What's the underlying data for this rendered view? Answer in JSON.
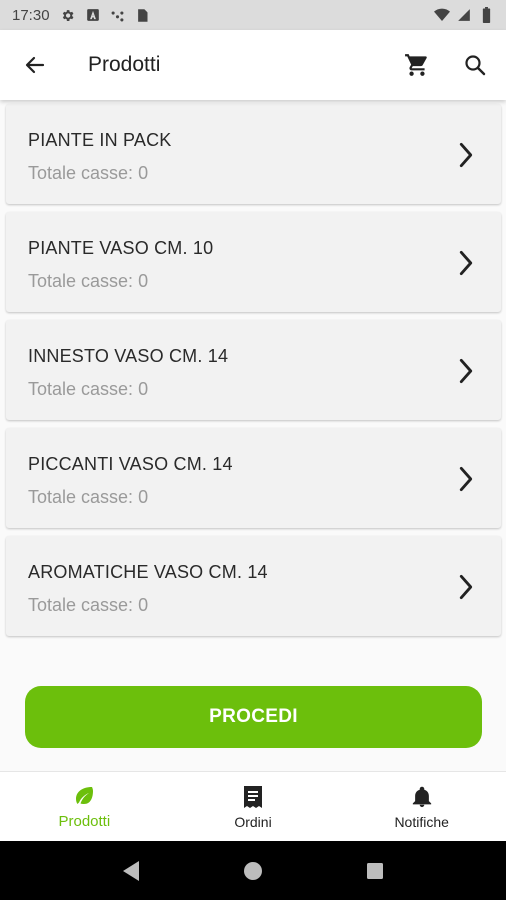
{
  "status_bar": {
    "time": "17:30",
    "icons_left": [
      "gear-icon",
      "a-icon",
      "wifi-dots-icon",
      "sim-icon"
    ],
    "icons_right": [
      "wifi-icon",
      "signal-icon",
      "battery-icon"
    ]
  },
  "app_bar": {
    "title": "Prodotti",
    "back_icon": "arrow-left-icon",
    "cart_icon": "cart-icon",
    "search_icon": "search-icon"
  },
  "categories": [
    {
      "title": "PIANTE IN PACK",
      "subtitle_label": "Totale casse:",
      "count": "0"
    },
    {
      "title": "PIANTE VASO CM. 10",
      "subtitle_label": "Totale casse:",
      "count": "0"
    },
    {
      "title": "INNESTO VASO CM. 14",
      "subtitle_label": "Totale casse:",
      "count": "0"
    },
    {
      "title": "PICCANTI VASO CM. 14",
      "subtitle_label": "Totale casse:",
      "count": "0"
    },
    {
      "title": "AROMATICHE VASO CM. 14",
      "subtitle_label": "Totale casse:",
      "count": "0"
    }
  ],
  "procedi_label": "PROCEDI",
  "bottom_nav": [
    {
      "label": "Prodotti",
      "icon": "leaf-icon",
      "active": true
    },
    {
      "label": "Ordini",
      "icon": "receipt-icon",
      "active": false
    },
    {
      "label": "Notifiche",
      "icon": "bell-icon",
      "active": false
    }
  ],
  "colors": {
    "accent": "#6cbf0c",
    "card_bg": "#f2f2f2",
    "status_bar": "#dcdcdc"
  }
}
